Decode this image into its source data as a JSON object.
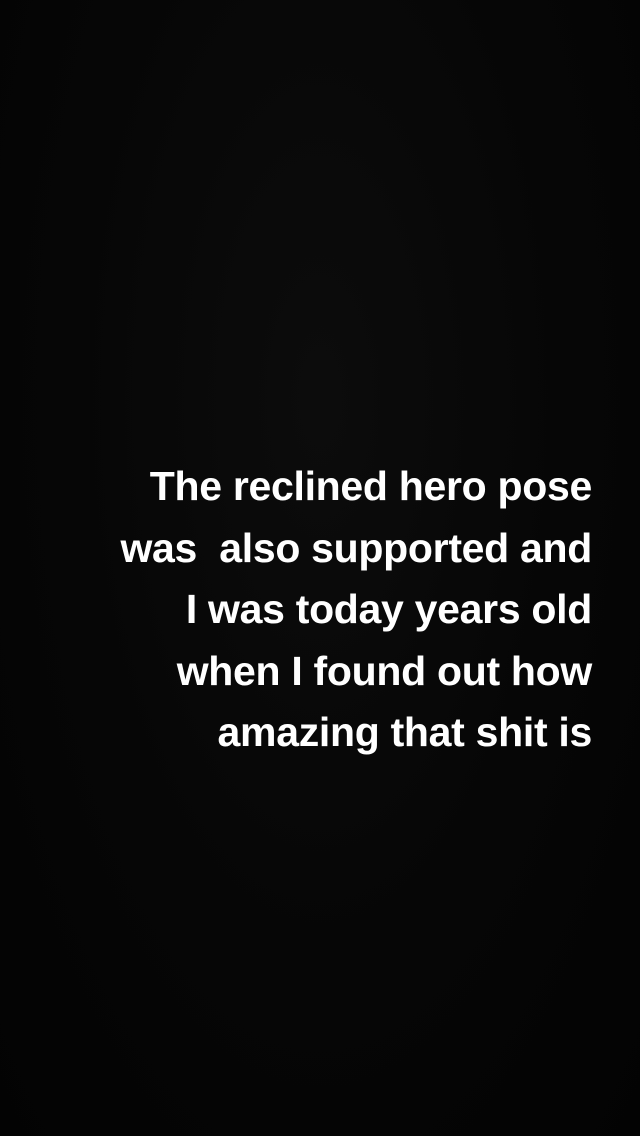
{
  "story": {
    "background_color": "#050505",
    "text_color": "#ffffff",
    "caption_lines": [
      "The reclined hero pose",
      "was  also supported and",
      "I was today years old",
      "when I found out how",
      "amazing that shit is"
    ]
  }
}
